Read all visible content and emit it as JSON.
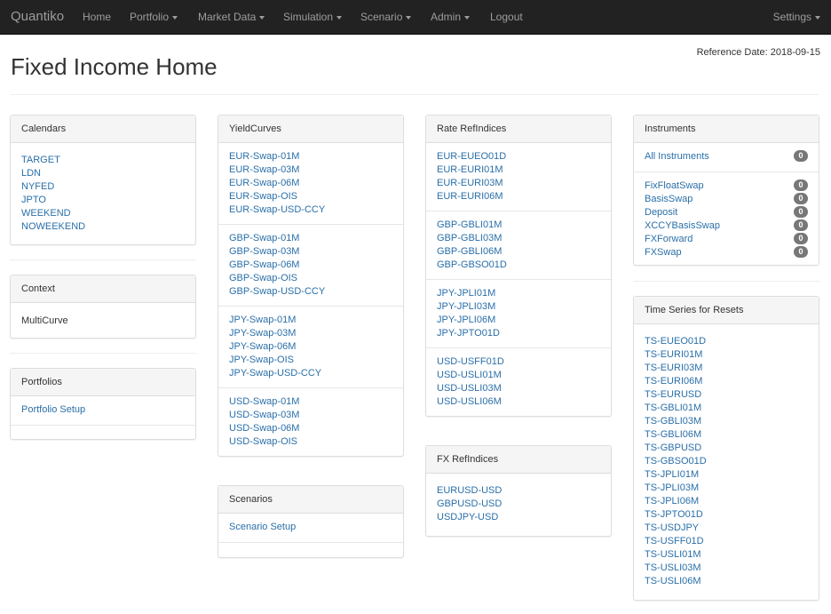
{
  "navbar": {
    "brand": "Quantiko",
    "items": [
      {
        "label": "Home"
      },
      {
        "label": "Portfolio"
      },
      {
        "label": "Market Data"
      },
      {
        "label": "Simulation"
      },
      {
        "label": "Scenario"
      },
      {
        "label": "Admin"
      },
      {
        "label": "Logout"
      }
    ],
    "settings": "Settings"
  },
  "header": {
    "title": "Fixed Income Home",
    "reference_date": "Reference Date: 2018-09-15"
  },
  "calendars": {
    "title": "Calendars",
    "items": [
      "TARGET",
      "LDN",
      "NYFED",
      "JPTO",
      "WEEKEND",
      "NOWEEKEND"
    ]
  },
  "context": {
    "title": "Context",
    "value": "MultiCurve"
  },
  "portfolios": {
    "title": "Portfolios",
    "link": "Portfolio Setup"
  },
  "yieldcurves": {
    "title": "YieldCurves",
    "groups": [
      [
        "EUR-Swap-01M",
        "EUR-Swap-03M",
        "EUR-Swap-06M",
        "EUR-Swap-OIS",
        "EUR-Swap-USD-CCY"
      ],
      [
        "GBP-Swap-01M",
        "GBP-Swap-03M",
        "GBP-Swap-06M",
        "GBP-Swap-OIS",
        "GBP-Swap-USD-CCY"
      ],
      [
        "JPY-Swap-01M",
        "JPY-Swap-03M",
        "JPY-Swap-06M",
        "JPY-Swap-OIS",
        "JPY-Swap-USD-CCY"
      ],
      [
        "USD-Swap-01M",
        "USD-Swap-03M",
        "USD-Swap-06M",
        "USD-Swap-OIS"
      ]
    ]
  },
  "scenarios": {
    "title": "Scenarios",
    "link": "Scenario Setup"
  },
  "rate_refindices": {
    "title": "Rate RefIndices",
    "groups": [
      [
        "EUR-EUEO01D",
        "EUR-EURI01M",
        "EUR-EURI03M",
        "EUR-EURI06M"
      ],
      [
        "GBP-GBLI01M",
        "GBP-GBLI03M",
        "GBP-GBLI06M",
        "GBP-GBSO01D"
      ],
      [
        "JPY-JPLI01M",
        "JPY-JPLI03M",
        "JPY-JPLI06M",
        "JPY-JPTO01D"
      ],
      [
        "USD-USFF01D",
        "USD-USLI01M",
        "USD-USLI03M",
        "USD-USLI06M"
      ]
    ]
  },
  "fx_refindices": {
    "title": "FX RefIndices",
    "items": [
      "EURUSD-USD",
      "GBPUSD-USD",
      "USDJPY-USD"
    ]
  },
  "instruments": {
    "title": "Instruments",
    "all": {
      "label": "All Instruments",
      "count": "0"
    },
    "items": [
      {
        "label": "FixFloatSwap",
        "count": "0"
      },
      {
        "label": "BasisSwap",
        "count": "0"
      },
      {
        "label": "Deposit",
        "count": "0"
      },
      {
        "label": "XCCYBasisSwap",
        "count": "0"
      },
      {
        "label": "FXForward",
        "count": "0"
      },
      {
        "label": "FXSwap",
        "count": "0"
      }
    ]
  },
  "time_series": {
    "title": "Time Series for Resets",
    "items": [
      "TS-EUEO01D",
      "TS-EURI01M",
      "TS-EURI03M",
      "TS-EURI06M",
      "TS-EURUSD",
      "TS-GBLI01M",
      "TS-GBLI03M",
      "TS-GBLI06M",
      "TS-GBPUSD",
      "TS-GBSO01D",
      "TS-JPLI01M",
      "TS-JPLI03M",
      "TS-JPLI06M",
      "TS-JPTO01D",
      "TS-USDJPY",
      "TS-USFF01D",
      "TS-USLI01M",
      "TS-USLI03M",
      "TS-USLI06M"
    ]
  }
}
